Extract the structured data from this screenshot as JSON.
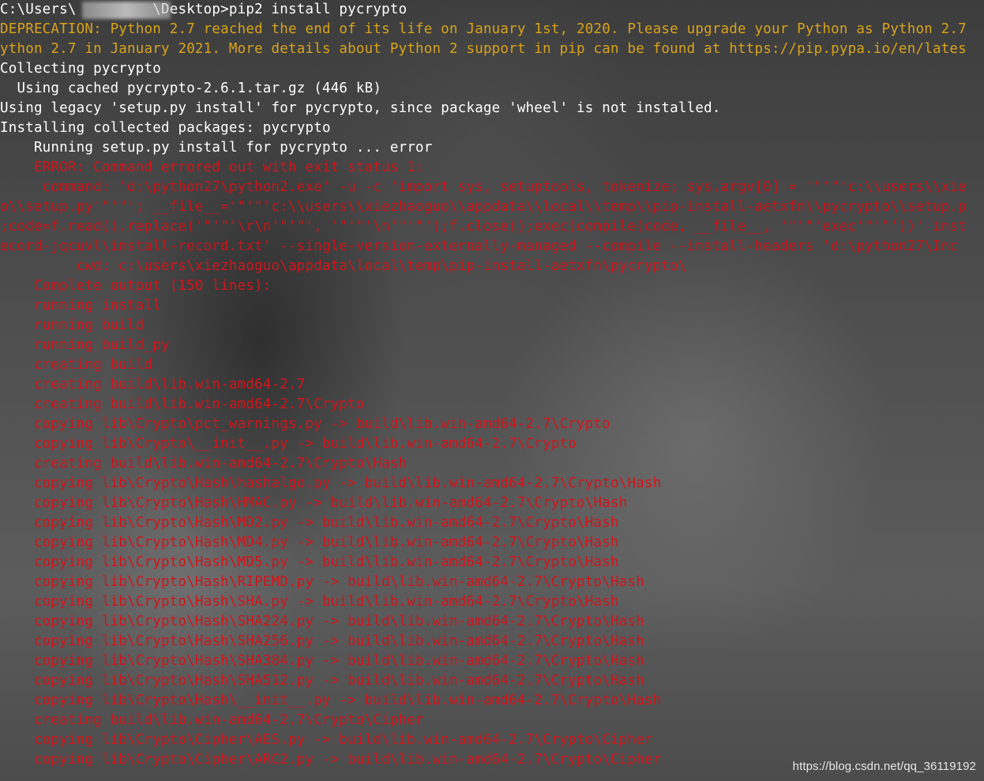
{
  "terminal": {
    "lines": [
      {
        "text": "C:\\Users\\         \\Desktop>pip2 install pycrypto",
        "color": "white"
      },
      {
        "text": "DEPRECATION: Python 2.7 reached the end of its life on January 1st, 2020. Please upgrade your Python as Python 2.7",
        "color": "yellow"
      },
      {
        "text": "ython 2.7 in January 2021. More details about Python 2 support in pip can be found at https://pip.pypa.io/en/lates",
        "color": "yellow"
      },
      {
        "text": "Collecting pycrypto",
        "color": "white"
      },
      {
        "text": "  Using cached pycrypto-2.6.1.tar.gz (446 kB)",
        "color": "white"
      },
      {
        "text": "Using legacy 'setup.py install' for pycrypto, since package 'wheel' is not installed.",
        "color": "white"
      },
      {
        "text": "Installing collected packages: pycrypto",
        "color": "white"
      },
      {
        "text": "    Running setup.py install for pycrypto ... error",
        "color": "white"
      },
      {
        "text": "    ERROR: Command errored out with exit status 1:",
        "color": "red"
      },
      {
        "text": "     command: 'd:\\python27\\python2.exe' -u -c 'import sys, setuptools, tokenize; sys.argv[0] = '\"'\"'c:\\\\users\\\\xie",
        "color": "red"
      },
      {
        "text": "o\\\\setup.py'\"'\"'; __file__='\"'\"'c:\\\\users\\\\xiezhaoguo\\\\appdata\\\\local\\\\temp\\\\pip-install-aetxfn\\\\pycrypto\\\\setup.p",
        "color": "red"
      },
      {
        "text": ";code=f.read().replace('\"'\"'\\r\\n'\"'\"', '\"'\"'\\n'\"'\"');f.close();exec(compile(code, __file__, '\"'\"'exec'\"'\"'))' inst",
        "color": "red"
      },
      {
        "text": "ecord-jqcuvl\\install-record.txt' --single-version-externally-managed --compile --install-headers 'd:\\python27\\Inc",
        "color": "red"
      },
      {
        "text": "         cwd: c:\\users\\xiezhaoguo\\appdata\\local\\temp\\pip-install-aetxfn\\pycrypto\\",
        "color": "red"
      },
      {
        "text": "    Complete output (150 lines):",
        "color": "red"
      },
      {
        "text": "    running install",
        "color": "red"
      },
      {
        "text": "    running build",
        "color": "red"
      },
      {
        "text": "    running build_py",
        "color": "red"
      },
      {
        "text": "    creating build",
        "color": "red"
      },
      {
        "text": "    creating build\\lib.win-amd64-2.7",
        "color": "red"
      },
      {
        "text": "    creating build\\lib.win-amd64-2.7\\Crypto",
        "color": "red"
      },
      {
        "text": "    copying lib\\Crypto\\pct_warnings.py -> build\\lib.win-amd64-2.7\\Crypto",
        "color": "red"
      },
      {
        "text": "    copying lib\\Crypto\\__init__.py -> build\\lib.win-amd64-2.7\\Crypto",
        "color": "red"
      },
      {
        "text": "    creating build\\lib.win-amd64-2.7\\Crypto\\Hash",
        "color": "red"
      },
      {
        "text": "    copying lib\\Crypto\\Hash\\hashalgo.py -> build\\lib.win-amd64-2.7\\Crypto\\Hash",
        "color": "red"
      },
      {
        "text": "    copying lib\\Crypto\\Hash\\HMAC.py -> build\\lib.win-amd64-2.7\\Crypto\\Hash",
        "color": "red"
      },
      {
        "text": "    copying lib\\Crypto\\Hash\\MD2.py -> build\\lib.win-amd64-2.7\\Crypto\\Hash",
        "color": "red"
      },
      {
        "text": "    copying lib\\Crypto\\Hash\\MD4.py -> build\\lib.win-amd64-2.7\\Crypto\\Hash",
        "color": "red"
      },
      {
        "text": "    copying lib\\Crypto\\Hash\\MD5.py -> build\\lib.win-amd64-2.7\\Crypto\\Hash",
        "color": "red"
      },
      {
        "text": "    copying lib\\Crypto\\Hash\\RIPEMD.py -> build\\lib.win-amd64-2.7\\Crypto\\Hash",
        "color": "red"
      },
      {
        "text": "    copying lib\\Crypto\\Hash\\SHA.py -> build\\lib.win-amd64-2.7\\Crypto\\Hash",
        "color": "red"
      },
      {
        "text": "    copying lib\\Crypto\\Hash\\SHA224.py -> build\\lib.win-amd64-2.7\\Crypto\\Hash",
        "color": "red"
      },
      {
        "text": "    copying lib\\Crypto\\Hash\\SHA256.py -> build\\lib.win-amd64-2.7\\Crypto\\Hash",
        "color": "red"
      },
      {
        "text": "    copying lib\\Crypto\\Hash\\SHA384.py -> build\\lib.win-amd64-2.7\\Crypto\\Hash",
        "color": "red"
      },
      {
        "text": "    copying lib\\Crypto\\Hash\\SHA512.py -> build\\lib.win-amd64-2.7\\Crypto\\Hash",
        "color": "red"
      },
      {
        "text": "    copying lib\\Crypto\\Hash\\__init__.py -> build\\lib.win-amd64-2.7\\Crypto\\Hash",
        "color": "red"
      },
      {
        "text": "    creating build\\lib.win-amd64-2.7\\Crypto\\Cipher",
        "color": "red"
      },
      {
        "text": "    copying lib\\Crypto\\Cipher\\AES.py -> build\\lib.win-amd64-2.7\\Crypto\\Cipher",
        "color": "red"
      },
      {
        "text": "    copying lib\\Crypto\\Cipher\\ARC2.py -> build\\lib.win-amd64-2.7\\Crypto\\Cipher",
        "color": "red"
      }
    ]
  },
  "watermark": "https://blog.csdn.net/qq_36119192",
  "colors": {
    "white": "#ffffff",
    "yellow": "#d7a31c",
    "red": "#d0151c"
  }
}
